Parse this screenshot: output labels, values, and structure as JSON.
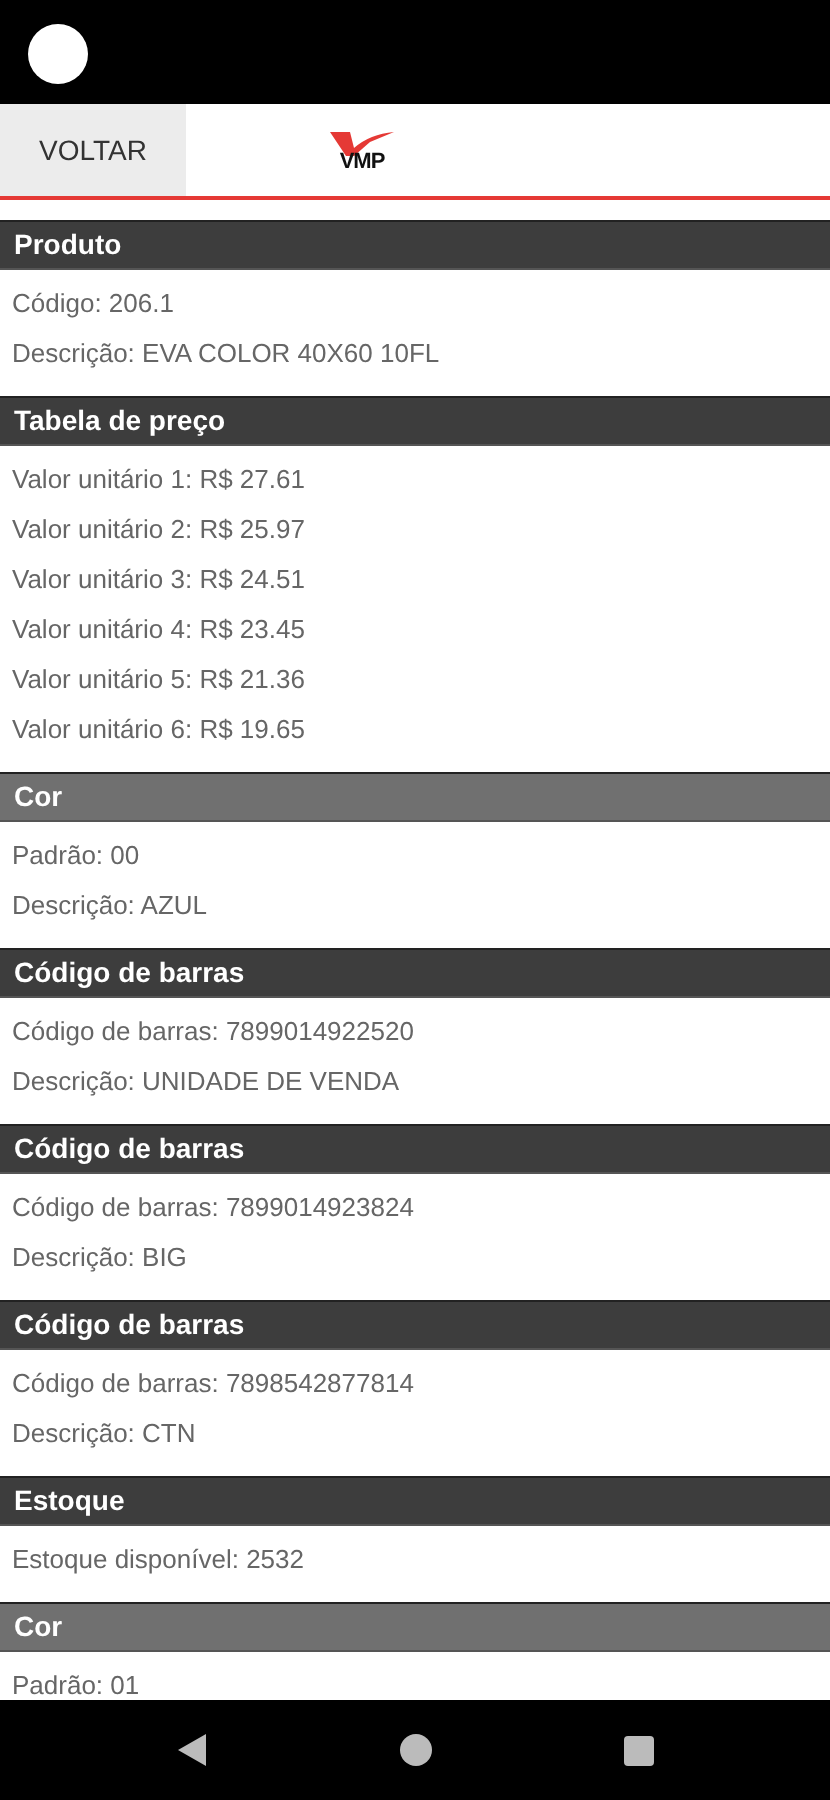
{
  "top_bar": {
    "back_button": "VOLTAR",
    "logo": "VMP"
  },
  "sections": [
    {
      "title": "Produto",
      "kind": "dark",
      "fields": [
        "Código: 206.1",
        "Descrição: EVA COLOR 40X60 10FL"
      ]
    },
    {
      "title": "Tabela de preço",
      "kind": "dark",
      "fields": [
        "Valor unitário 1: R$ 27.61",
        "Valor unitário 2: R$ 25.97",
        "Valor unitário 3: R$ 24.51",
        "Valor unitário 4: R$ 23.45",
        "Valor unitário 5: R$ 21.36",
        "Valor unitário 6: R$ 19.65"
      ]
    },
    {
      "title": "Cor",
      "kind": "light",
      "fields": [
        "Padrão: 00",
        "Descrição: AZUL"
      ]
    },
    {
      "title": "Código de barras",
      "kind": "dark",
      "fields": [
        "Código de barras: 7899014922520",
        "Descrição: UNIDADE DE VENDA"
      ]
    },
    {
      "title": "Código de barras",
      "kind": "dark",
      "fields": [
        "Código de barras: 7899014923824",
        "Descrição: BIG"
      ]
    },
    {
      "title": "Código de barras",
      "kind": "dark",
      "fields": [
        "Código de barras: 7898542877814",
        "Descrição: CTN"
      ]
    },
    {
      "title": "Estoque",
      "kind": "dark",
      "fields": [
        "Estoque disponível: 2532"
      ]
    },
    {
      "title": "Cor",
      "kind": "light",
      "fields": [
        "Padrão: 01"
      ]
    }
  ]
}
